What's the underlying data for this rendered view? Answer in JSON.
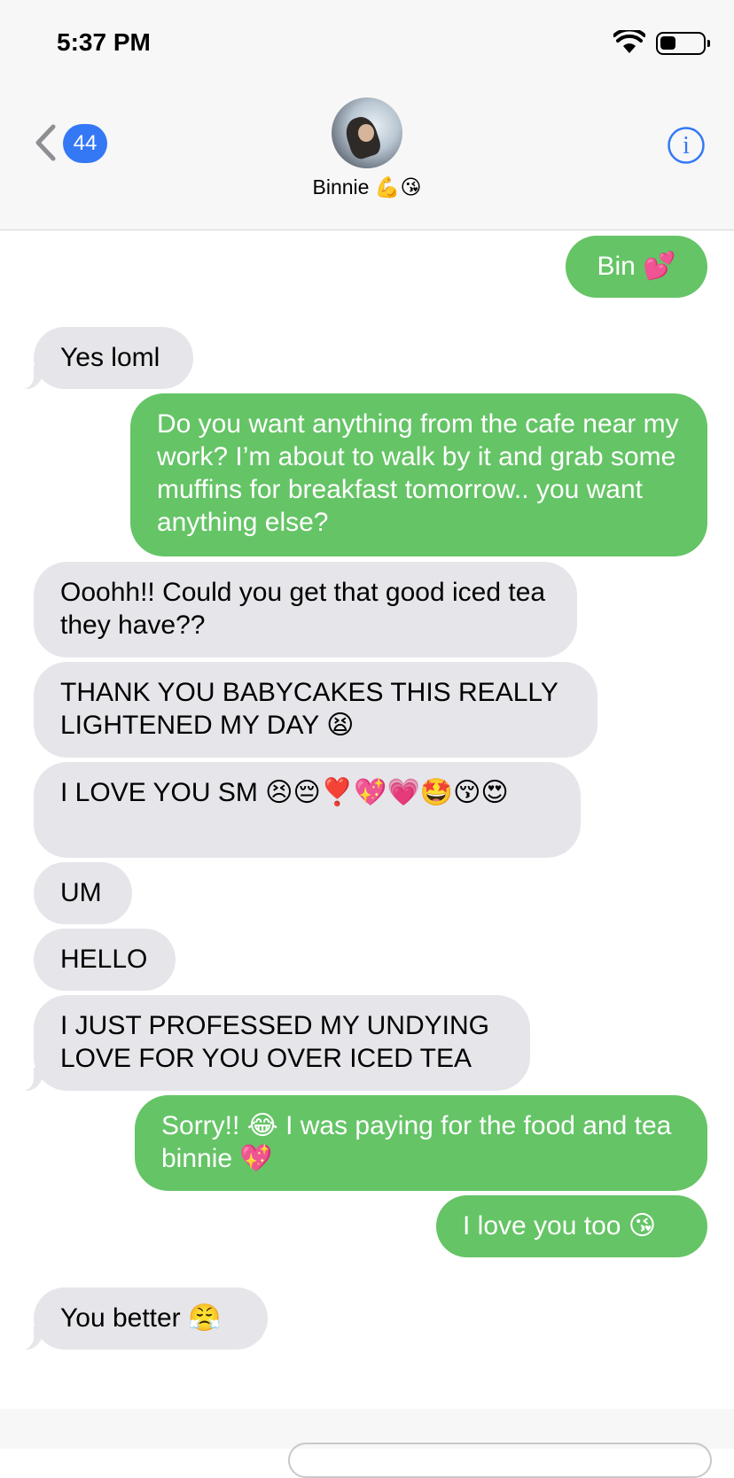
{
  "status_bar": {
    "time": "5:37 PM"
  },
  "nav": {
    "back_badge": "44",
    "contact_name": "Binnie 💪😘"
  },
  "messages": [
    {
      "dir": "out",
      "text": "Bin 💕"
    },
    {
      "dir": "in",
      "text": "Yes loml"
    },
    {
      "dir": "out",
      "text": "Do you want anything from the cafe near my work? I’m about to walk by it and grab some muffins for breakfast tomorrow.. you want anything else?"
    },
    {
      "dir": "in",
      "text": "Ooohh!! Could you get that good iced tea they have??"
    },
    {
      "dir": "in",
      "text": "THANK YOU BABYCAKES THIS REALLY LIGHTENED MY DAY 😫"
    },
    {
      "dir": "in",
      "text": "I LOVE YOU SM 😣😔❣️💖💗🤩😚😍"
    },
    {
      "dir": "in",
      "text": "UM"
    },
    {
      "dir": "in",
      "text": "HELLO"
    },
    {
      "dir": "in",
      "text": "I JUST PROFESSED MY UNDYING LOVE FOR YOU OVER ICED TEA"
    },
    {
      "dir": "out",
      "text": "Sorry!! 😂 I was paying for the food and tea binnie 💖"
    },
    {
      "dir": "out",
      "text": "I love you too 😘"
    },
    {
      "dir": "in",
      "text": "You better 😤"
    }
  ],
  "colors": {
    "outgoing": "#65c466",
    "incoming": "#e5e5ea",
    "accent": "#3478f6"
  }
}
